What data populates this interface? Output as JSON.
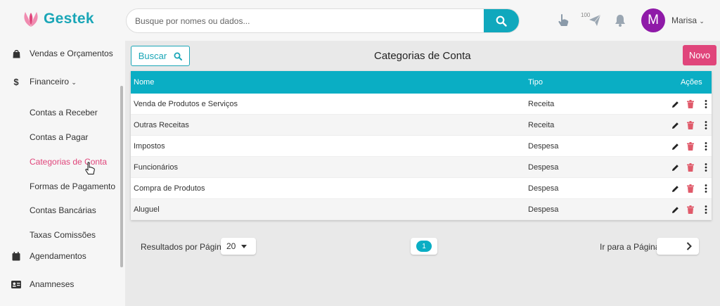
{
  "app": {
    "name": "Gestek"
  },
  "header": {
    "search_placeholder": "Busque por nomes ou dados...",
    "badge": "100",
    "user_initial": "M",
    "user_name": "Marisa"
  },
  "sidebar": {
    "vendas": "Vendas e Orçamentos",
    "financeiro": "Financeiro",
    "sub": [
      "Contas a Receber",
      "Contas a Pagar",
      "Categorias de Conta",
      "Formas de Pagamento",
      "Contas Bancárias",
      "Taxas Comissões"
    ],
    "agendamentos": "Agendamentos",
    "anamneses": "Anamneses"
  },
  "main": {
    "buscar_label": "Buscar",
    "title": "Categorias de Conta",
    "novo_label": "Novo"
  },
  "table": {
    "headers": {
      "nome": "Nome",
      "tipo": "Tipo",
      "acoes": "Ações"
    },
    "rows": [
      {
        "nome": "Venda de Produtos e Serviços",
        "tipo": "Receita"
      },
      {
        "nome": "Outras Receitas",
        "tipo": "Receita"
      },
      {
        "nome": "Impostos",
        "tipo": "Despesa"
      },
      {
        "nome": "Funcionários",
        "tipo": "Despesa"
      },
      {
        "nome": "Compra de Produtos",
        "tipo": "Despesa"
      },
      {
        "nome": "Aluguel",
        "tipo": "Despesa"
      }
    ]
  },
  "footer": {
    "rpp_label": "Resultados por Página",
    "rpp_value": "20",
    "current_page": "1",
    "goto_label": "Ir para a Página"
  },
  "colors": {
    "accent": "#0aaec4",
    "brand_pink": "#e0457b",
    "avatar": "#8f1aa8",
    "delete": "#e05a6a"
  }
}
